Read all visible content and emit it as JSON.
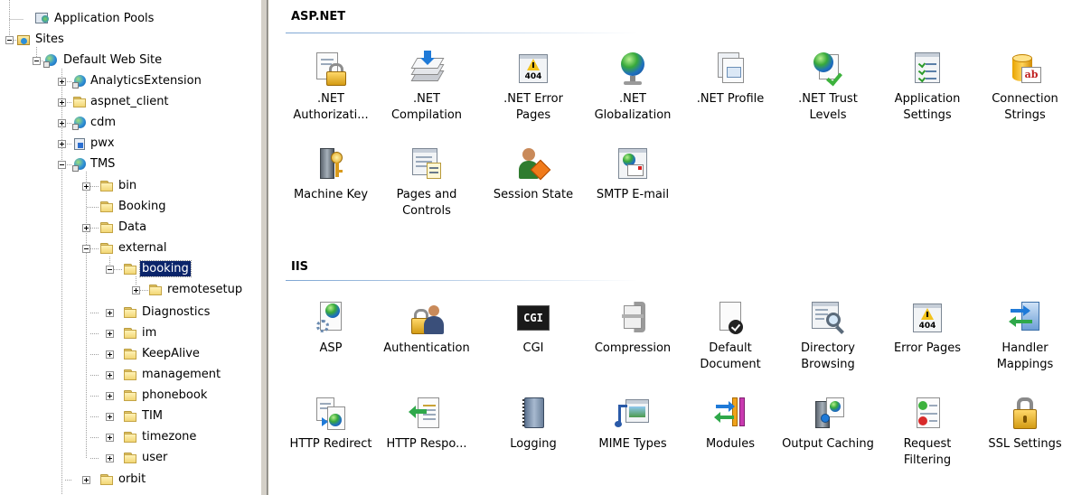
{
  "tree": {
    "nodes": [
      {
        "label": "Application Pools",
        "icon": "app-pool-icon"
      },
      {
        "label": "Sites",
        "icon": "sites-folder-icon"
      },
      {
        "label": "Default Web Site",
        "icon": "website-globe-icon"
      },
      {
        "label": "AnalyticsExtension",
        "icon": "application-icon"
      },
      {
        "label": "aspnet_client",
        "icon": "folder-icon"
      },
      {
        "label": "cdm",
        "icon": "application-icon"
      },
      {
        "label": "pwx",
        "icon": "virtual-directory-icon"
      },
      {
        "label": "TMS",
        "icon": "application-icon"
      },
      {
        "label": "bin",
        "icon": "folder-icon"
      },
      {
        "label": "Booking",
        "icon": "folder-icon"
      },
      {
        "label": "Data",
        "icon": "folder-icon"
      },
      {
        "label": "external",
        "icon": "folder-icon"
      },
      {
        "label": "booking",
        "icon": "folder-icon"
      },
      {
        "label": "remotesetup",
        "icon": "folder-icon"
      },
      {
        "label": "Diagnostics",
        "icon": "folder-icon"
      },
      {
        "label": "im",
        "icon": "folder-icon"
      },
      {
        "label": "KeepAlive",
        "icon": "folder-icon"
      },
      {
        "label": "management",
        "icon": "folder-icon"
      },
      {
        "label": "phonebook",
        "icon": "folder-icon"
      },
      {
        "label": "TIM",
        "icon": "folder-icon"
      },
      {
        "label": "timezone",
        "icon": "folder-icon"
      },
      {
        "label": "user",
        "icon": "folder-icon"
      },
      {
        "label": "orbit",
        "icon": "folder-icon"
      }
    ],
    "selected": "booking"
  },
  "groups": {
    "aspnet": {
      "title": "ASP.NET",
      "items": [
        {
          "label": ".NET Authorizati...",
          "icon": "net-authorization-icon"
        },
        {
          "label": ".NET Compilation",
          "icon": "net-compilation-icon"
        },
        {
          "label": ".NET Error Pages",
          "icon": "net-error-pages-icon"
        },
        {
          "label": ".NET Globalization",
          "icon": "net-globalization-icon"
        },
        {
          "label": ".NET Profile",
          "icon": "net-profile-icon"
        },
        {
          "label": ".NET Trust Levels",
          "icon": "net-trust-levels-icon"
        },
        {
          "label": "Application Settings",
          "icon": "application-settings-icon"
        },
        {
          "label": "Connection Strings",
          "icon": "connection-strings-icon"
        },
        {
          "label": "Machine Key",
          "icon": "machine-key-icon"
        },
        {
          "label": "Pages and Controls",
          "icon": "pages-controls-icon"
        },
        {
          "label": "Session State",
          "icon": "session-state-icon"
        },
        {
          "label": "SMTP E-mail",
          "icon": "smtp-email-icon"
        }
      ]
    },
    "iis": {
      "title": "IIS",
      "items": [
        {
          "label": "ASP",
          "icon": "asp-icon"
        },
        {
          "label": "Authentication",
          "icon": "authentication-icon"
        },
        {
          "label": "CGI",
          "icon": "cgi-icon"
        },
        {
          "label": "Compression",
          "icon": "compression-icon"
        },
        {
          "label": "Default Document",
          "icon": "default-document-icon"
        },
        {
          "label": "Directory Browsing",
          "icon": "directory-browsing-icon"
        },
        {
          "label": "Error Pages",
          "icon": "error-pages-icon"
        },
        {
          "label": "Handler Mappings",
          "icon": "handler-mappings-icon"
        },
        {
          "label": "HTTP Redirect",
          "icon": "http-redirect-icon"
        },
        {
          "label": "HTTP Respo...",
          "icon": "http-response-headers-icon"
        },
        {
          "label": "Logging",
          "icon": "logging-icon"
        },
        {
          "label": "MIME Types",
          "icon": "mime-types-icon"
        },
        {
          "label": "Modules",
          "icon": "modules-icon"
        },
        {
          "label": "Output Caching",
          "icon": "output-caching-icon"
        },
        {
          "label": "Request Filtering",
          "icon": "request-filtering-icon"
        },
        {
          "label": "SSL Settings",
          "icon": "ssl-settings-icon"
        }
      ]
    }
  },
  "cgi_badge": "CGI",
  "error_badge": "404",
  "colors": {
    "selection": "#0a246a",
    "header_line": "#7ea6d3"
  }
}
